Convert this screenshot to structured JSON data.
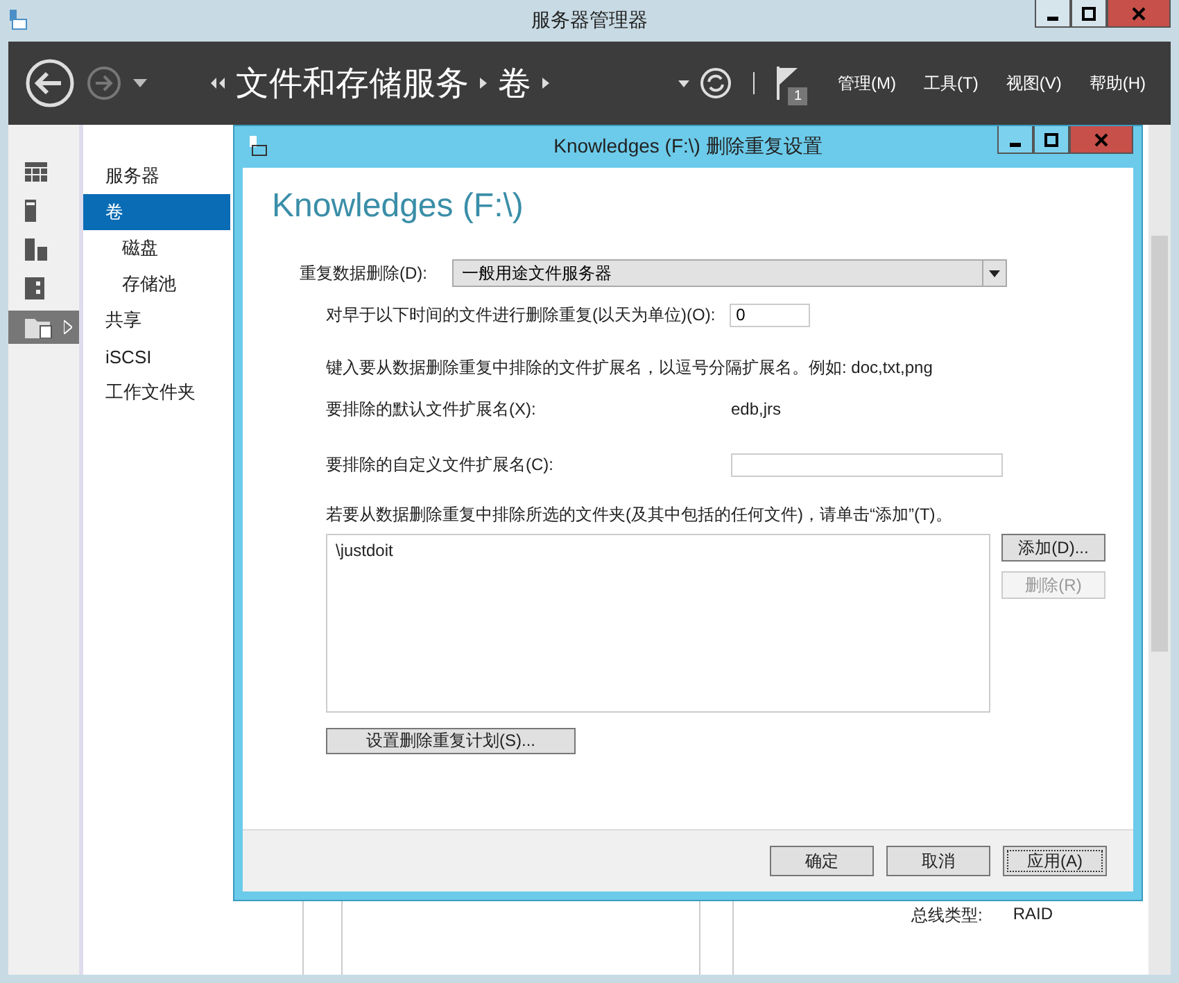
{
  "window": {
    "title": "服务器管理器"
  },
  "header": {
    "breadcrumb": [
      "文件和存储服务",
      "卷"
    ],
    "notification_count": "1",
    "menus": [
      "管理(M)",
      "工具(T)",
      "视图(V)",
      "帮助(H)"
    ]
  },
  "icon_strip": [
    {
      "kind": "dashboard",
      "selected": false
    },
    {
      "kind": "local",
      "selected": false
    },
    {
      "kind": "all",
      "selected": false
    },
    {
      "kind": "roles",
      "selected": false
    },
    {
      "kind": "files",
      "selected": true
    }
  ],
  "nav": [
    {
      "label": "服务器",
      "selected": false
    },
    {
      "label": "卷",
      "selected": true,
      "children": [
        {
          "label": "磁盘",
          "selected": false
        },
        {
          "label": "存储池",
          "selected": false
        }
      ]
    },
    {
      "label": "共享",
      "selected": false
    },
    {
      "label": "iSCSI",
      "selected": false
    },
    {
      "label": "工作文件夹",
      "selected": false
    }
  ],
  "background_details": [
    {
      "label": "总线类型:",
      "value": "RAID"
    }
  ],
  "dialog": {
    "title": "Knowledges (F:\\) 删除重复设置",
    "heading": "Knowledges (F:\\)",
    "dedup_label": "重复数据删除(D):",
    "dedup_value": "一般用途文件服务器",
    "age_label": "对早于以下时间的文件进行删除重复(以天为单位)(O):",
    "age_value": "0",
    "ext_hint": "键入要从数据删除重复中排除的文件扩展名，以逗号分隔扩展名。例如: doc,txt,png",
    "default_ext_label": "要排除的默认文件扩展名(X):",
    "default_ext_value": "edb,jrs",
    "custom_ext_label": "要排除的自定义文件扩展名(C):",
    "folder_hint": "若要从数据删除重复中排除所选的文件夹(及其中包括的任何文件)，请单击“添加”(T)。",
    "folders": [
      "\\justdoit"
    ],
    "side_buttons": [
      {
        "label": "添加(D)...",
        "disabled": false
      },
      {
        "label": "删除(R)",
        "disabled": true
      }
    ],
    "schedule_button": "设置删除重复计划(S)...",
    "footer_buttons": [
      {
        "label": "确定",
        "focused": false
      },
      {
        "label": "取消",
        "focused": false
      },
      {
        "label": "应用(A)",
        "focused": true
      }
    ]
  }
}
